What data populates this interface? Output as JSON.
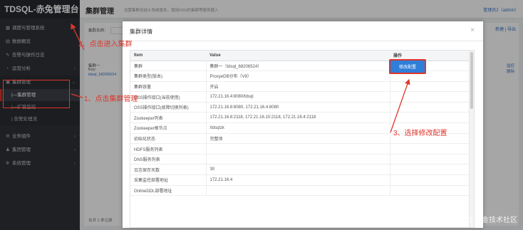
{
  "app": {
    "brand": "TDSQL-赤兔管理台"
  },
  "sidebar": {
    "items": [
      {
        "label": "调度与管理系统",
        "icon": "grid-icon"
      },
      {
        "label": "数据概览",
        "icon": "chart-icon"
      },
      {
        "label": "告警与操作日志",
        "icon": "wrench-icon"
      },
      {
        "label": "运营分析",
        "icon": "analytics-icon"
      },
      {
        "label": "集群管理",
        "icon": "cluster-icon"
      }
    ],
    "subitems": [
      {
        "label": "|—集群管理"
      },
      {
        "label": "|—扩容监控"
      },
      {
        "label": "| 告警处理流"
      }
    ],
    "more": [
      {
        "label": "业务组件",
        "icon": "gear-icon"
      },
      {
        "label": "集团管理",
        "icon": "user-icon"
      },
      {
        "label": "系统管理",
        "icon": "settings-icon"
      }
    ]
  },
  "topbar": {
    "title": "集群管理",
    "desc": "设置集群总结士系统版本，使用OSS的集群等服务器入",
    "user_prefix": "管理员2（",
    "user_name": "admin",
    "user_suffix": "）"
  },
  "background": {
    "search_label": "集群名称：",
    "right_actions": "新建 | 导出",
    "row1": "集群一",
    "row2": "Key:",
    "row3": "tdsql_68206524",
    "op1": "监控",
    "op2": "删除",
    "pager": "合共 1 条记录"
  },
  "modal": {
    "title": "集群详情",
    "close": "×",
    "columns": [
      "Item",
      "Value",
      "操作"
    ],
    "rows": [
      {
        "item": "集群",
        "value": "集群一（tdsql_68206524）"
      },
      {
        "item": "集群类型(版本)",
        "value": "ProxyeDB分布（V8）"
      },
      {
        "item": "集群容量",
        "value": "开启"
      },
      {
        "item": "OSS操作接口(当前使用)",
        "value": "172.21.16.4:8080/tdsql"
      },
      {
        "item": "OSS操作接口(故障切换列表)",
        "value": "172.21.16.8:8080, 172.21.16.4:8080"
      },
      {
        "item": "Zookeeper列表",
        "value": "172.21.16.8:2118, 172.21.16.10:2118, 172.21.16.4:2118"
      },
      {
        "item": "Zookeeper根节点",
        "value": "/tdsqlzk"
      },
      {
        "item": "初始化状态",
        "value": "完整项"
      },
      {
        "item": "HDFS服务列表",
        "value": ""
      },
      {
        "item": "DNS服务列表",
        "value": ""
      },
      {
        "item": "日志保存天数",
        "value": "30"
      },
      {
        "item": "采集监控部署地址",
        "value": "172.21.16.4"
      },
      {
        "item": "OnlineDDL部署地址",
        "value": ""
      }
    ],
    "modify_button": "修改配置"
  },
  "annotations": {
    "step1": "1、点击集群管理",
    "step2": "2、点击进入集群",
    "step3": "3、选择修改配置"
  },
  "watermark": "@稀土掘金技术社区",
  "colors": {
    "annotation_red": "#e0352b",
    "button_blue": "#2f7ed8",
    "sidebar_bg": "#2f3238"
  }
}
